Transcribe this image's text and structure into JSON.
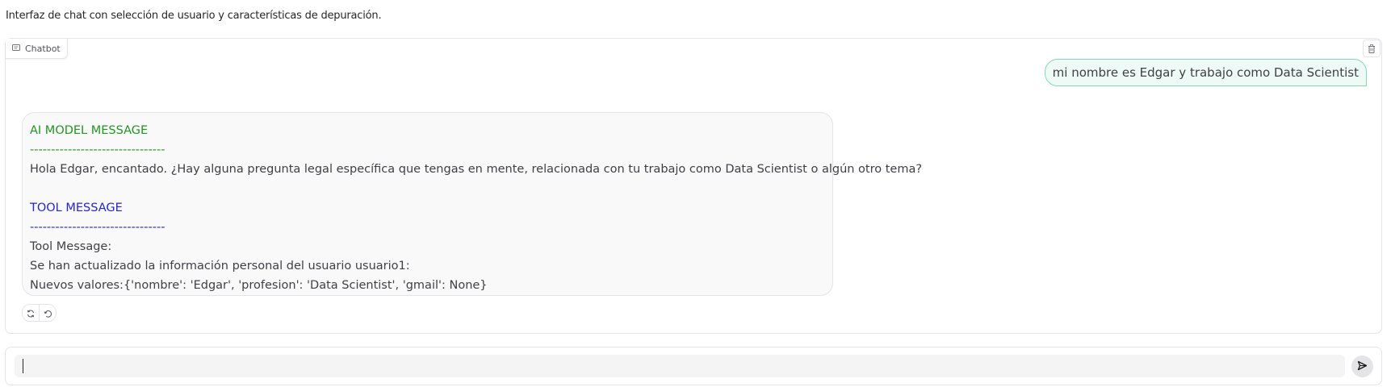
{
  "header": {
    "description": "Interfaz de chat con selección de usuario y características de depuración."
  },
  "chatbot": {
    "label": "Chatbot",
    "label_icon": "chat-icon",
    "clear_icon": "trash-icon",
    "user_message": "mi nombre es Edgar y trabajo como Data Scientist",
    "bot_message": {
      "ai_title": "AI MODEL MESSAGE",
      "ai_divider": "--------------------------------",
      "ai_text": "Hola Edgar, encantado. ¿Hay alguna pregunta legal específica que tengas en mente, relacionada con tu trabajo como Data Scientist o algún otro tema?",
      "tool_title": "TOOL MESSAGE",
      "tool_divider": "--------------------------------",
      "tool_line1": "Tool Message:",
      "tool_line2": "Se han actualizado la información personal del usuario usuario1:",
      "tool_line3": "Nuevos valores:{'nombre': 'Edgar', 'profesion': 'Data Scientist', 'gmail': None}"
    },
    "actions": [
      "retry-icon",
      "undo-icon"
    ]
  },
  "input": {
    "value": "",
    "placeholder": "",
    "send_icon": "send-icon"
  },
  "colors": {
    "ai_title": "#229522",
    "tool_title": "#2424d4",
    "user_bubble_bg": "#eefaf5",
    "user_bubble_border": "#86d7b5"
  }
}
